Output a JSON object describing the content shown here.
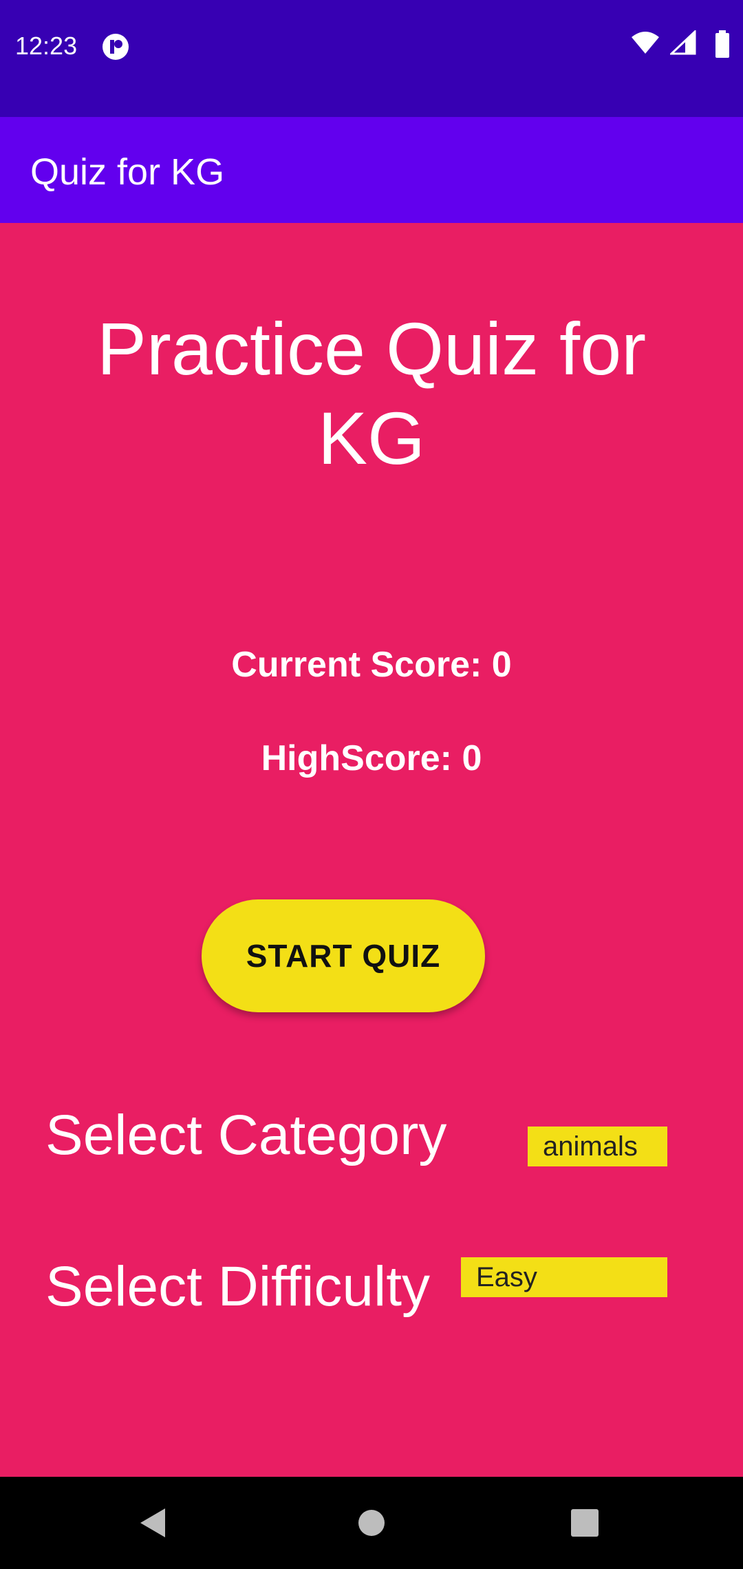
{
  "status_bar": {
    "time": "12:23",
    "icons": [
      "app-notification-icon",
      "wifi-icon",
      "cell-signal-icon",
      "battery-icon"
    ]
  },
  "app_bar": {
    "title": "Quiz for KG"
  },
  "main": {
    "headline": "Practice Quiz for KG",
    "current_score_text": "Current Score: 0",
    "high_score_text": "HighScore: 0",
    "start_button_label": "START QUIZ",
    "category_label": "Select Category",
    "category_value": "animals",
    "difficulty_label": "Select Difficulty",
    "difficulty_value": "Easy"
  },
  "nav_bar": {
    "icons": [
      "back-icon",
      "home-icon",
      "recents-icon"
    ]
  },
  "colors": {
    "status_bar": "#3700B3",
    "app_bar": "#6200EE",
    "background": "#E91E63",
    "accent_yellow": "#F3DF16",
    "nav_bar": "#000000"
  }
}
